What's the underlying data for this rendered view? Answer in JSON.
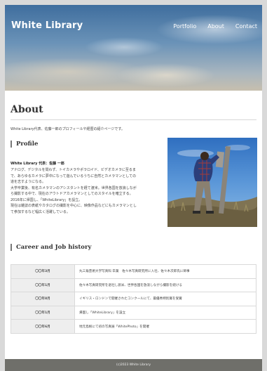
{
  "header": {
    "logo": "White Library",
    "nav": [
      {
        "label": "Portfolio"
      },
      {
        "label": "About"
      },
      {
        "label": "Contact"
      }
    ]
  },
  "about": {
    "title": "About",
    "intro": "White Library代表、佐藤一郎のプロフィールや経歴の紹介ページです。"
  },
  "profile": {
    "heading": "Profile",
    "name": "White Library 代表：佐藤 一郎",
    "bio": [
      "アナログ、デジタルを問わず、トイカメラやポラロイド、ビデオカメラに至るま",
      "で、あらゆるカメラに夢中になって遊んでいるうちに自然とカメラマンとしての",
      "道を志すようになる。",
      "大学卒業後、有名カメラマンのアシスタントを経て渡米。世界各国を放浪しなが",
      "ら撮影する中で、現在のアウトドアカメラマンとしてのスタイルを確立する。",
      "2016年に帰国し、「WhiteLibrary」を設立。",
      "現在は雑誌の表紙やカタログの撮影を中心に、映像作品などにもカメラマンとし",
      "て参加するなど幅広く活躍している。"
    ]
  },
  "career": {
    "heading": "Career and Job history",
    "rows": [
      {
        "date": "〇〇年3月",
        "text": "丸三角芸術大学写真科 卒業　佐々木写真研究所に入社、佐々木次郎氏に師事"
      },
      {
        "date": "〇〇年1月",
        "text": "佐々木写真研究所を退社し渡米、世界各国を放浪しながら撮影を続ける"
      },
      {
        "date": "〇〇年8月",
        "text": "イギリス・ロンドンで開催されたコンクールにて、最優秀特別賞を受賞"
      },
      {
        "date": "〇〇年1月",
        "text": "帰国し「WhiteLibrary」を設立"
      },
      {
        "date": "〇〇年6月",
        "text": "地元島根にて初の写真展「WhitePhoto」を開催"
      }
    ]
  },
  "footer": {
    "copyright": "(c)2023 White Library"
  }
}
